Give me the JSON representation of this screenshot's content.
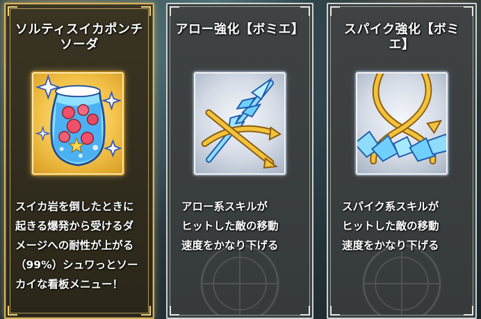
{
  "cards": [
    {
      "title_line1": "ソルティスイカポンチ",
      "title_line2": "ソーダ",
      "icon": "fruit-punch-jar-icon",
      "desc_lines": [
        "スイカ岩を倒したときに",
        "起きる爆発から受けるダ",
        "メージへの耐性が上がる",
        "（99%）シュワっとソー",
        "カイな看板メニュー！"
      ],
      "selected": true
    },
    {
      "title_line1": "アロー強化【ボミエ】",
      "title_line2": "",
      "icon": "ice-arrow-bind-icon",
      "desc_lines": [
        "アロー系スキルが",
        "ヒットした敵の移動",
        "速度をかなり下げる"
      ],
      "selected": false
    },
    {
      "title_line1": "スパイク強化【ボミ",
      "title_line2": "エ】",
      "icon": "ice-spike-bind-icon",
      "desc_lines": [
        "スパイク系スキルが",
        "ヒットした敵の移動",
        "速度をかなり下げる"
      ],
      "selected": false
    }
  ],
  "colors": {
    "selected_border": "#d8b25a",
    "normal_border": "#cfd4d6",
    "gold_icon_bg": "#f3c24a",
    "silver_icon_bg": "#d4dbe6",
    "ice_blue": "#6fd0ff",
    "bind_gold": "#f2c33a"
  }
}
